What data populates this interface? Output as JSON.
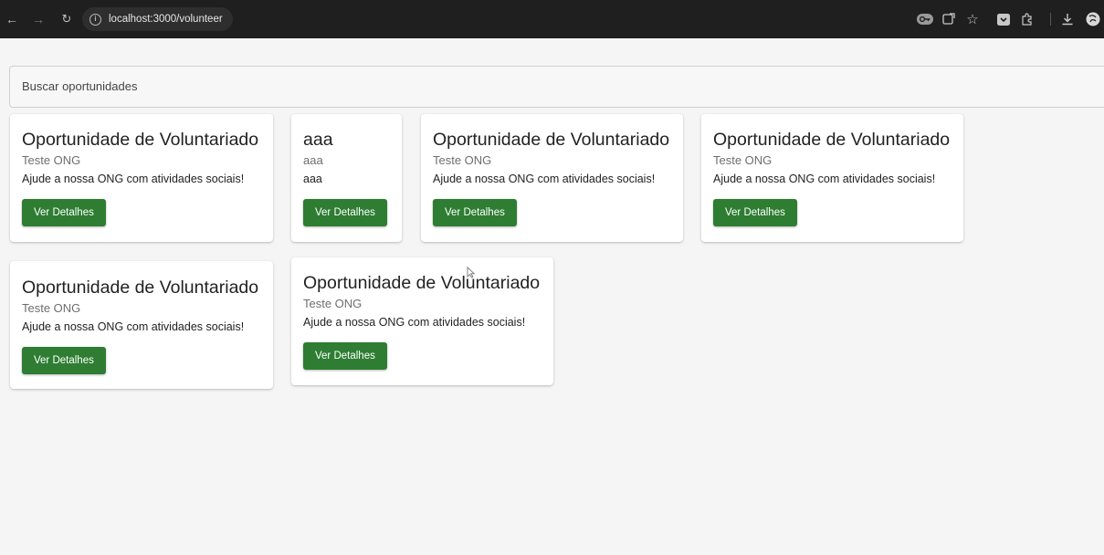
{
  "browser": {
    "url": "localhost:3000/volunteer",
    "icons": [
      "back-arrow-icon",
      "forward-arrow-icon",
      "reload-icon",
      "site-info-icon",
      "password-key-icon",
      "install-app-icon",
      "bookmark-star-icon",
      "pocket-icon",
      "extensions-icon",
      "download-icon",
      "profile-icon"
    ]
  },
  "search": {
    "placeholder": "Buscar oportunidades"
  },
  "cards": [
    {
      "title": "Oportunidade de Voluntariado",
      "org": "Teste ONG",
      "description": "Ajude a nossa ONG com atividades sociais!",
      "button": "Ver Detalhes"
    },
    {
      "title": "aaa",
      "org": "aaa",
      "description": "aaa",
      "button": "Ver Detalhes"
    },
    {
      "title": "Oportunidade de Voluntariado",
      "org": "Teste ONG",
      "description": "Ajude a nossa ONG com atividades sociais!",
      "button": "Ver Detalhes"
    },
    {
      "title": "Oportunidade de Voluntariado",
      "org": "Teste ONG",
      "description": "Ajude a nossa ONG com atividades sociais!",
      "button": "Ver Detalhes"
    },
    {
      "title": "Oportunidade de Voluntariado",
      "org": "Teste ONG",
      "description": "Ajude a nossa ONG com atividades sociais!",
      "button": "Ver Detalhes"
    },
    {
      "title": "Oportunidade de Voluntariado",
      "org": "Teste ONG",
      "description": "Ajude a nossa ONG com atividades sociais!",
      "button": "Ver Detalhes"
    }
  ],
  "colors": {
    "button": "#2e7d32",
    "browser_bar": "#1f1f1f",
    "page_bg": "#f5f5f5"
  }
}
